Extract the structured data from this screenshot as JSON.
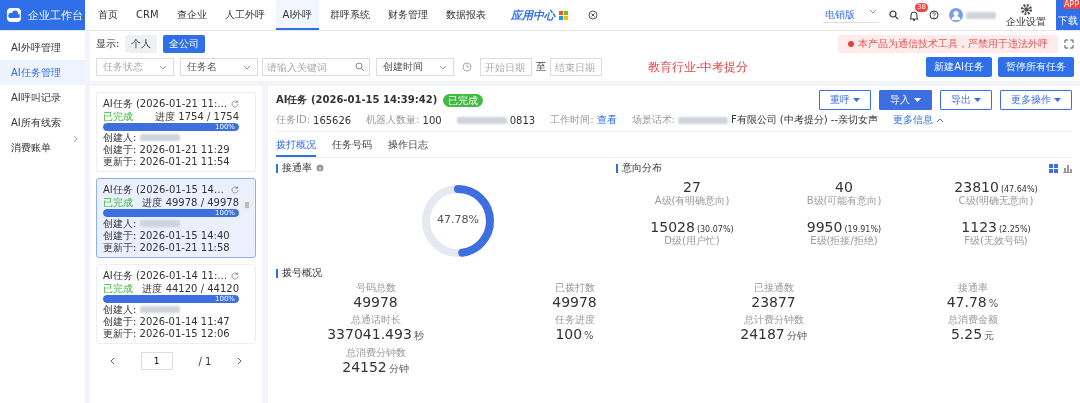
{
  "topbar": {
    "brand": "企业工作台",
    "nav": [
      {
        "label": "首页",
        "selected": false
      },
      {
        "label": "CRM",
        "selected": false
      },
      {
        "label": "查企业",
        "selected": false
      },
      {
        "label": "人工外呼",
        "selected": false
      },
      {
        "label": "AI外呼",
        "selected": true
      },
      {
        "label": "群呼系统",
        "selected": false
      },
      {
        "label": "财务管理",
        "selected": false
      },
      {
        "label": "数据报表",
        "selected": false
      }
    ],
    "app_center": "应用中心",
    "edition": "电销版",
    "notification_count": "38",
    "settings": "企业设置",
    "download": "下载",
    "download_badge": "APP"
  },
  "sidebar": {
    "items": [
      {
        "label": "AI外呼管理",
        "selected": false,
        "kind": "link"
      },
      {
        "label": "AI任务管理",
        "selected": true,
        "kind": "link"
      },
      {
        "label": "AI呼叫记录",
        "selected": false,
        "kind": "link"
      },
      {
        "label": "AI所有线索",
        "selected": false,
        "kind": "link"
      },
      {
        "label": "消费账单",
        "selected": false,
        "kind": "group"
      }
    ]
  },
  "filters": {
    "display_label": "显示:",
    "display_options": [
      {
        "label": "个人",
        "selected": false
      },
      {
        "label": "全公司",
        "selected": true
      }
    ],
    "status_placeholder": "任务状态",
    "name_select": "任务名",
    "keyword_placeholder": "请输入关键词",
    "time_select": "创建时间",
    "start_placeholder": "开始日期",
    "separator": "至",
    "end_placeholder": "结束日期",
    "banner": "教育行业-中考提分",
    "notice": "本产品为通信技术工具，严禁用于违法外呼",
    "buttons": [
      "新建AI任务",
      "暂停所有任务"
    ]
  },
  "tasks": [
    {
      "title": "AI任务 (2026-01-21 11:…",
      "status": "已完成",
      "progress": "进度 1754 / 1754",
      "level": 1,
      "percent": "100%",
      "creator_label": "创建人:",
      "created": "创建于: 2026-01-21 11:29",
      "updated": "更新于: 2026-01-21 11:54",
      "selected": false
    },
    {
      "title": "AI任务 (2026-01-15 14…",
      "status": "已完成",
      "progress": "进度 49978 / 49978",
      "level": 1,
      "percent": "100%",
      "creator_label": "创建人:",
      "created": "创建于: 2026-01-15 14:40",
      "updated": "更新于: 2026-01-21 11:58",
      "selected": true
    },
    {
      "title": "AI任务 (2026-01-14 11:…",
      "status": "已完成",
      "progress": "进度 44120 / 44120",
      "level": 1,
      "percent": "100%",
      "creator_label": "创建人:",
      "created": "创建于: 2026-01-14 11:47",
      "updated": "更新于: 2026-01-15 12:06",
      "selected": false
    }
  ],
  "pagination": {
    "page": "1",
    "total": "/ 1"
  },
  "detail": {
    "title": "AI任务 (2026-01-15 14:39:42)",
    "status": "已完成",
    "task_id_label": "任务ID:",
    "task_id": "165626",
    "robots_label": "机器人数量:",
    "robots": "100",
    "caller_tail": "0813",
    "work_time_label": "工作时间:",
    "work_time_link": "查看",
    "script_label": "场景话术:",
    "script": "F有限公司 (中考提分) --亲切女声",
    "more": "更多信息",
    "actions": [
      {
        "label": "重呼",
        "primary": false
      },
      {
        "label": "导入",
        "primary": true
      },
      {
        "label": "导出",
        "primary": false
      },
      {
        "label": "更多操作",
        "primary": false
      }
    ],
    "tabs": [
      {
        "label": "拨打概况",
        "selected": true
      },
      {
        "label": "任务号码",
        "selected": false
      },
      {
        "label": "操作日志",
        "selected": false
      }
    ]
  },
  "connection": {
    "title": "接通率",
    "level": 0.4778,
    "reading": "47.78%"
  },
  "intent": {
    "title": "意向分布",
    "view_modes": [
      {
        "kind": "grid",
        "selected": true
      },
      {
        "kind": "chart",
        "selected": false
      }
    ],
    "items": [
      {
        "value": "27",
        "label": "A级(有明确意向)"
      },
      {
        "value": "40",
        "label": "B级(可能有意向)"
      },
      {
        "value": "23810",
        "share": "(47.64%)",
        "label": "C级(明确无意向)"
      },
      {
        "value": "15028",
        "share": "(30.07%)",
        "label": "D级(用户忙)"
      },
      {
        "value": "9950",
        "share": "(19.91%)",
        "label": "E级(拒接/拒绝)"
      },
      {
        "value": "1123",
        "share": "(2.25%)",
        "label": "F级(无效号码)"
      }
    ]
  },
  "dial": {
    "title": "拨号概况",
    "items": [
      {
        "label": "号码总数",
        "value": "49978"
      },
      {
        "label": "已拨打数",
        "value": "49978"
      },
      {
        "label": "已接通数",
        "value": "23877"
      },
      {
        "label": "接通率",
        "value": "47.78",
        "unit": "%"
      },
      {
        "label": "总通话时长",
        "value": "337041.493",
        "unit": "秒"
      },
      {
        "label": "任务进度",
        "value": "100",
        "unit": "%"
      },
      {
        "label": "总计费分钟数",
        "value": "24187",
        "unit": "分钟"
      },
      {
        "label": "总消费金额",
        "value": "5.25",
        "unit": "元"
      },
      {
        "label": "总消费分钟数",
        "value": "24152",
        "unit": "分钟"
      }
    ]
  }
}
